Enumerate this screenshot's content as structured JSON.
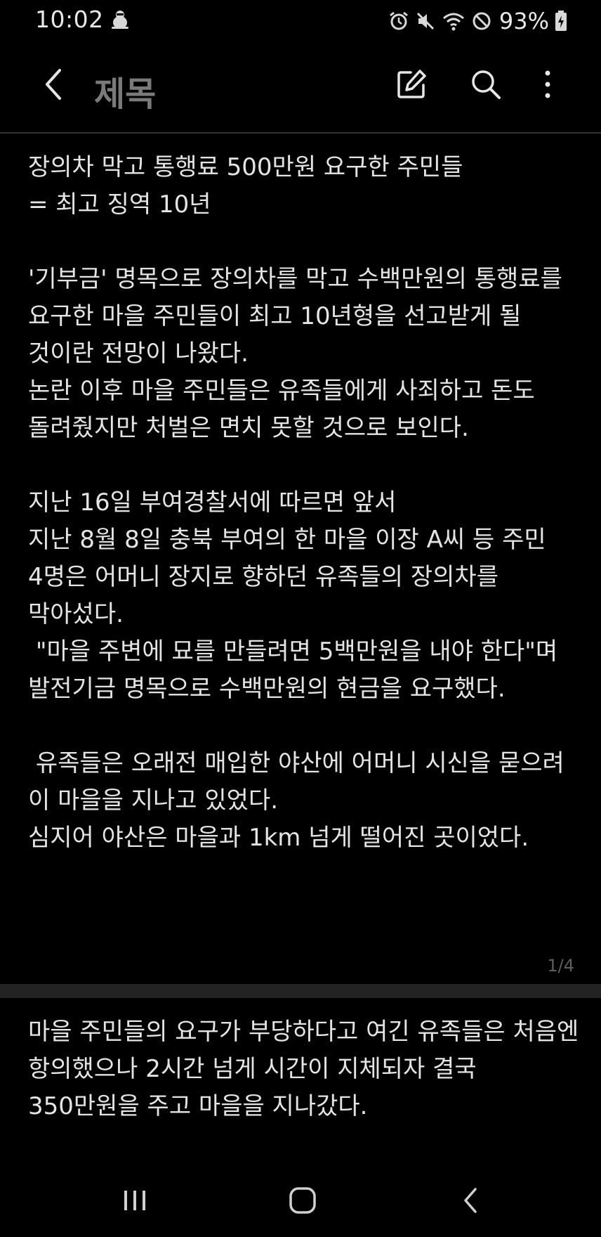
{
  "status_bar": {
    "time": "10:02",
    "battery": "93%",
    "icons": [
      "notification-icon",
      "alarm-icon",
      "mute-icon",
      "wifi-icon",
      "blocked-icon",
      "battery-icon"
    ]
  },
  "app_bar": {
    "title": "제목",
    "icons": [
      "back-icon",
      "edit-icon",
      "search-icon",
      "more-icon"
    ]
  },
  "pages": [
    {
      "text": "장의차 막고 통행료 500만원 요구한 주민들\n= 최고 징역 10년\n\n'기부금' 명목으로 장의차를 막고 수백만원의 통행료를 요구한 마을 주민들이 최고 10년형을 선고받게 될 것이란 전망이 나왔다.\n논란 이후 마을 주민들은 유족들에게 사죄하고 돈도 돌려줬지만 처벌은 면치 못할 것으로 보인다.\n\n지난 16일 부여경찰서에 따르면 앞서\n지난 8월 8일 충북 부여의 한 마을 이장 A씨 등 주민 4명은 어머니 장지로 향하던 유족들의 장의차를 막아섰다.\n \"마을 주변에 묘를 만들려면 5백만원을 내야 한다\"며 발전기금 명목으로 수백만원의 현금을 요구했다.\n\n 유족들은 오래전 매입한 야산에 어머니 시신을 묻으려 이 마을을 지나고 있었다.\n심지어 야산은 마을과 1km 넘게 떨어진 곳이었다.",
      "indicator": "1/4"
    },
    {
      "text": "마을 주민들의 요구가 부당하다고 여긴 유족들은 처음엔 항의했으나 2시간 넘게 시간이 지체되자 결국 350만원을 주고 마을을 지나갔다."
    }
  ],
  "nav_bar": {
    "icons": [
      "recents-icon",
      "home-icon",
      "nav-back-icon"
    ]
  },
  "colors": {
    "background": "#000000",
    "text": "#e4e4e4",
    "title": "#7a7a7a",
    "divider": "#232323"
  }
}
